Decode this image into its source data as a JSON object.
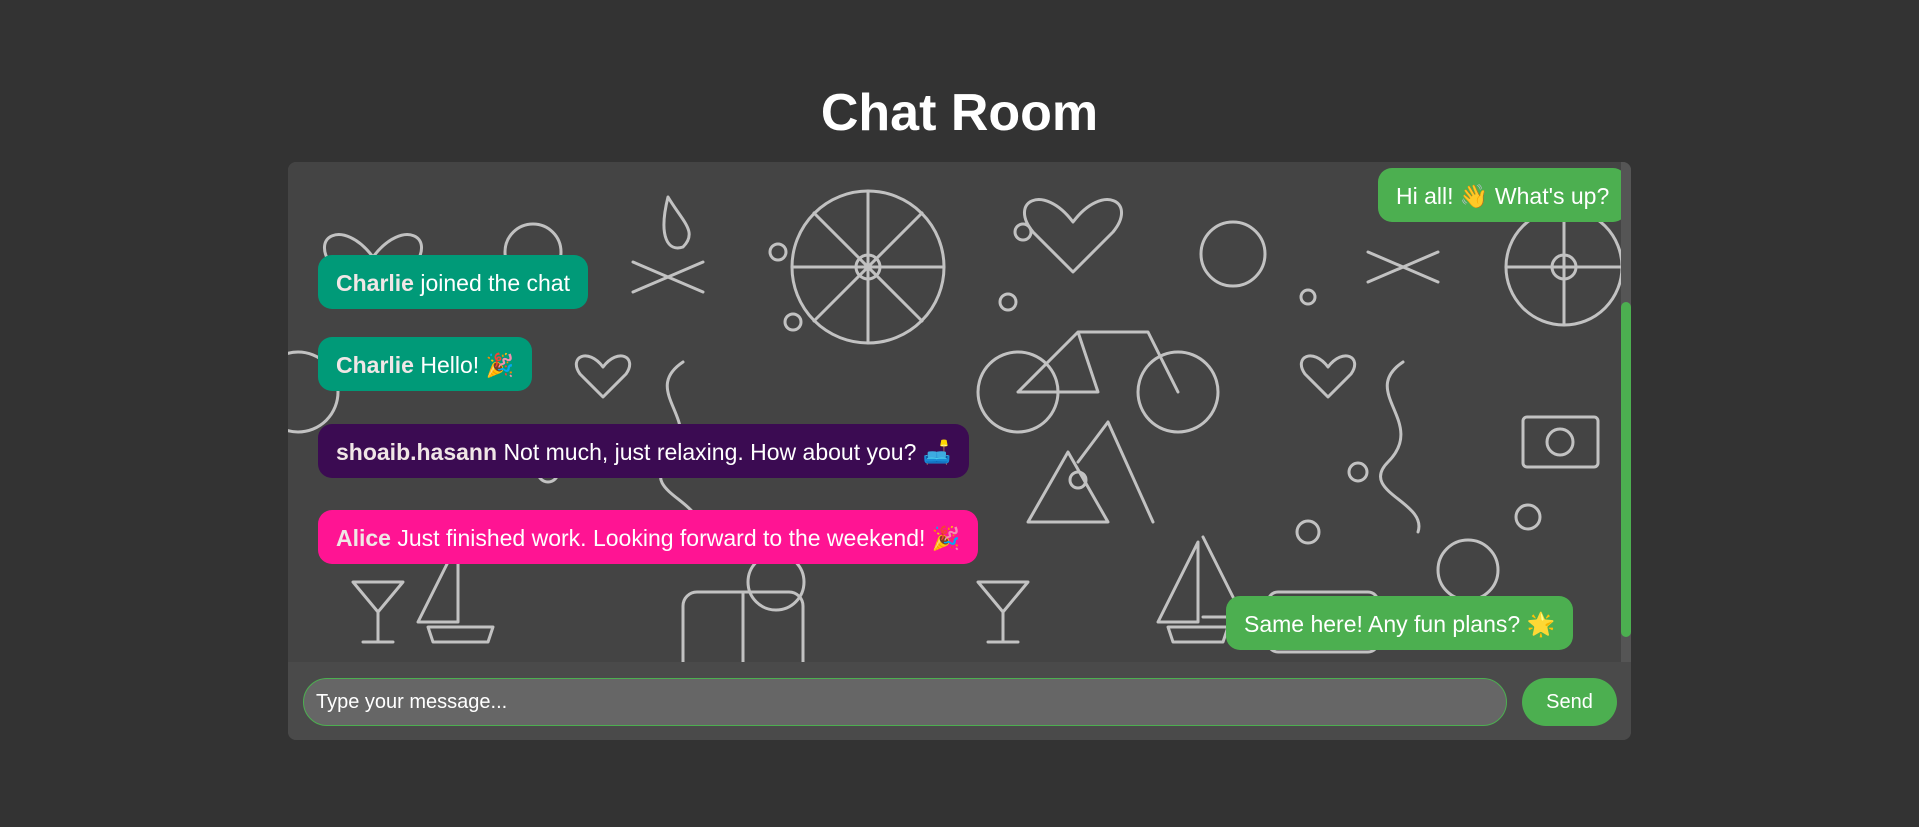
{
  "page": {
    "title": "Chat Room"
  },
  "colors": {
    "page_background": "#333333",
    "accent": "#4caf50",
    "own_message": "#4caf50",
    "charlie_message": "#009a78",
    "shoaib_message": "#3b0b52",
    "alice_message": "#ff1493"
  },
  "messages": [
    {
      "side": "right",
      "sender": "",
      "text": "Hi all! 👋 What's up?"
    },
    {
      "side": "left",
      "sender": "Charlie",
      "text": "joined the chat"
    },
    {
      "side": "left",
      "sender": "Charlie",
      "text": "Hello! 🎉"
    },
    {
      "side": "left",
      "sender": "shoaib.hasann",
      "text": "Not much, just relaxing. How about you? 🛋️"
    },
    {
      "side": "left",
      "sender": "Alice",
      "text": "Just finished work. Looking forward to the weekend! 🎉"
    },
    {
      "side": "right",
      "sender": "",
      "text": "Same here! Any fun plans? 🌟"
    }
  ],
  "composer": {
    "placeholder": "Type your message...",
    "send_label": "Send"
  }
}
